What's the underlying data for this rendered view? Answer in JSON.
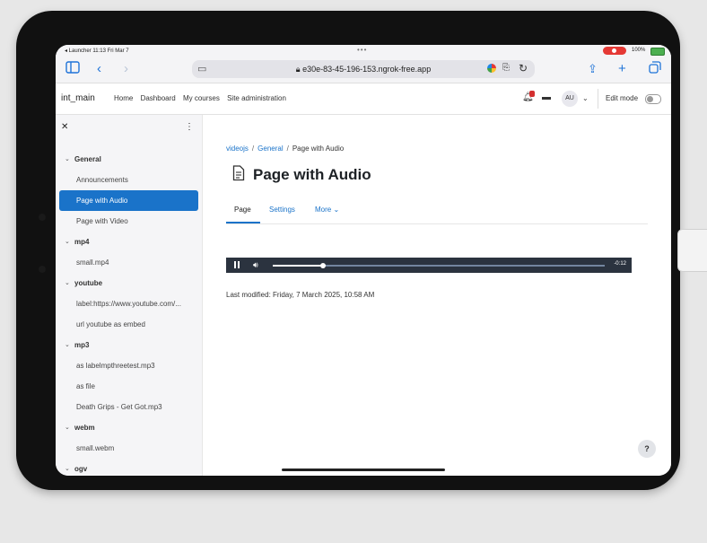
{
  "status_bar": {
    "back_app": "◂ Launcher",
    "time": "11:13",
    "date": "Fri Mar 7",
    "battery": "100%"
  },
  "browser": {
    "url": "e30e-83-45-196-153.ngrok-free.app",
    "lock_icon": "lock-icon"
  },
  "navbar": {
    "brand": "int_main",
    "links": [
      "Home",
      "Dashboard",
      "My courses",
      "Site administration"
    ],
    "avatar_initials": "AU",
    "edit_mode_label": "Edit mode",
    "edit_mode_on": false
  },
  "drawer": {
    "items": [
      {
        "type": "section",
        "label": "General"
      },
      {
        "type": "item",
        "label": "Announcements"
      },
      {
        "type": "item",
        "label": "Page with Audio",
        "active": true
      },
      {
        "type": "item",
        "label": "Page with Video"
      },
      {
        "type": "section",
        "label": "mp4"
      },
      {
        "type": "item",
        "label": "small.mp4"
      },
      {
        "type": "section",
        "label": "youtube"
      },
      {
        "type": "item",
        "label": "label:https://www.youtube.com/..."
      },
      {
        "type": "item",
        "label": "url youtube as embed"
      },
      {
        "type": "section",
        "label": "mp3"
      },
      {
        "type": "item",
        "label": "as labelmpthreetest.mp3"
      },
      {
        "type": "item",
        "label": "as file"
      },
      {
        "type": "item",
        "label": "Death Grips - Get Got.mp3"
      },
      {
        "type": "section",
        "label": "webm"
      },
      {
        "type": "item",
        "label": "small.webm"
      },
      {
        "type": "section",
        "label": "ogv"
      }
    ]
  },
  "breadcrumb": {
    "course": "videojs",
    "section": "General",
    "current": "Page with Audio",
    "separator": "/"
  },
  "page": {
    "title": "Page with Audio",
    "tabs": [
      {
        "label": "Page",
        "active": true
      },
      {
        "label": "Settings"
      },
      {
        "label": "More ⌄"
      }
    ],
    "player": {
      "remaining_time": "-0:12",
      "progress": 0.15
    },
    "last_modified": "Last modified: Friday, 7 March 2025, 10:58 AM"
  },
  "help_button": "?"
}
